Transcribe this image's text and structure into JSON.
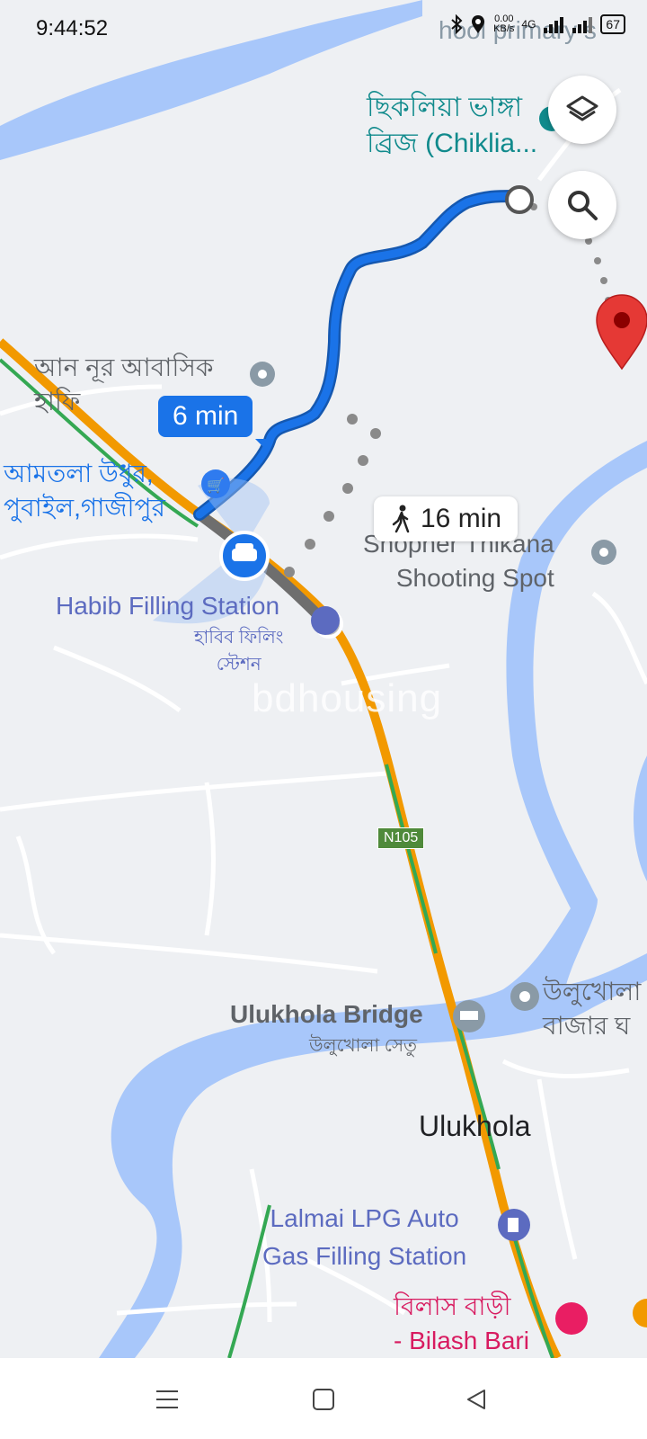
{
  "status_bar": {
    "time": "9:44:52",
    "net_speed_value": "0.00",
    "net_speed_unit": "KB/s",
    "network_type": "4G",
    "battery": "67"
  },
  "map": {
    "route": {
      "drive_time": "6 min",
      "walk_time": "16 min"
    },
    "places": [
      {
        "id": "chiklia-bridge",
        "text": "ছিকলিয়া ভাঙ্গা\nব্রিজ (Chiklia..."
      },
      {
        "id": "an-nur",
        "text": "আন নূর আবাসিক\nহাফি"
      },
      {
        "id": "amtola",
        "text": "আমতলা উধুর,\nপুবাইল,গাজীপুর"
      },
      {
        "id": "habib-en",
        "text": "Habib Filling Station"
      },
      {
        "id": "habib-bn",
        "text": "হাবিব ফিলিং\nস্টেশন"
      },
      {
        "id": "shopner",
        "text": "Shopner Thikana\nShooting Spot"
      },
      {
        "id": "ulukhola-bridge-en",
        "text": "Ulukhola Bridge"
      },
      {
        "id": "ulukhola-bridge-bn",
        "text": "উলুখোলা সেতু"
      },
      {
        "id": "ulukhola-bazar",
        "text": "উলুখোলা\nবাজার ঘ"
      },
      {
        "id": "ulukhola",
        "text": "Ulukhola"
      },
      {
        "id": "lalmai",
        "text": "Lalmai LPG Auto\nGas Filling Station"
      },
      {
        "id": "bilash",
        "text": "বিলাস বাড়ী\n- Bilash Bari"
      },
      {
        "id": "primary",
        "text": "hool primary s"
      }
    ],
    "road_shield": "N105",
    "watermark": "bdhousing"
  },
  "icons": {
    "layers": "layers-icon",
    "search": "search-icon",
    "destination": "destination-pin-icon",
    "car": "car-icon",
    "walk": "walking-person-icon"
  },
  "colors": {
    "water": "#a8c7fa",
    "route": "#1a73e8",
    "route_outline": "#1558b0",
    "traffic_orange": "#f29900",
    "traffic_green": "#34a853",
    "pin_red": "#e53935",
    "teal_label": "#108a8c",
    "blue_label": "#1a73e8",
    "poi_purple": "#5c6bc0",
    "pink_label": "#d81b60"
  }
}
